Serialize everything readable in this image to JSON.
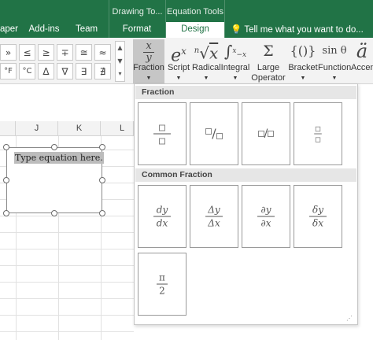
{
  "ribbon": {
    "contextual_groups": {
      "drawing_tools": "Drawing To...",
      "equation_tools": "Equation Tools"
    },
    "tabs": [
      {
        "label": "aper"
      },
      {
        "label": "Add-ins"
      },
      {
        "label": "Team"
      },
      {
        "label": "Format"
      },
      {
        "label": "Design"
      }
    ],
    "tell_me": "Tell me what you want to do...",
    "symbols_row1": [
      "»",
      "≤",
      "≥",
      "∓",
      "≅",
      "≈"
    ],
    "symbols_row2": [
      "°F",
      "°C",
      "Δ",
      "∇",
      "∃",
      "∄"
    ],
    "structures": [
      {
        "label": "Fraction",
        "icon": "x/y"
      },
      {
        "label": "Script",
        "icon": "eˣ"
      },
      {
        "label": "Radical",
        "icon": "ⁿ√x"
      },
      {
        "label": "Integral",
        "icon": "∫"
      },
      {
        "label": "Large",
        "label2": "Operator",
        "icon": "Σ"
      },
      {
        "label": "Bracket",
        "icon": "{()}"
      },
      {
        "label": "Function",
        "icon": "sin θ"
      },
      {
        "label": "Accen",
        "icon": "ä"
      }
    ]
  },
  "sheet": {
    "columns": [
      "J",
      "K",
      "L"
    ],
    "equation_placeholder": "Type equation here."
  },
  "gallery": {
    "section1_title": "Fraction",
    "section2_title": "Common Fraction",
    "common": [
      {
        "num": "dy",
        "den": "dx"
      },
      {
        "num": "Δy",
        "den": "Δx"
      },
      {
        "num": "∂y",
        "den": "∂x"
      },
      {
        "num": "δy",
        "den": "δx"
      },
      {
        "num": "π",
        "den": "2"
      }
    ]
  },
  "colors": {
    "ribbon_green": "#217346",
    "selected_button": "#c6c6c6"
  }
}
